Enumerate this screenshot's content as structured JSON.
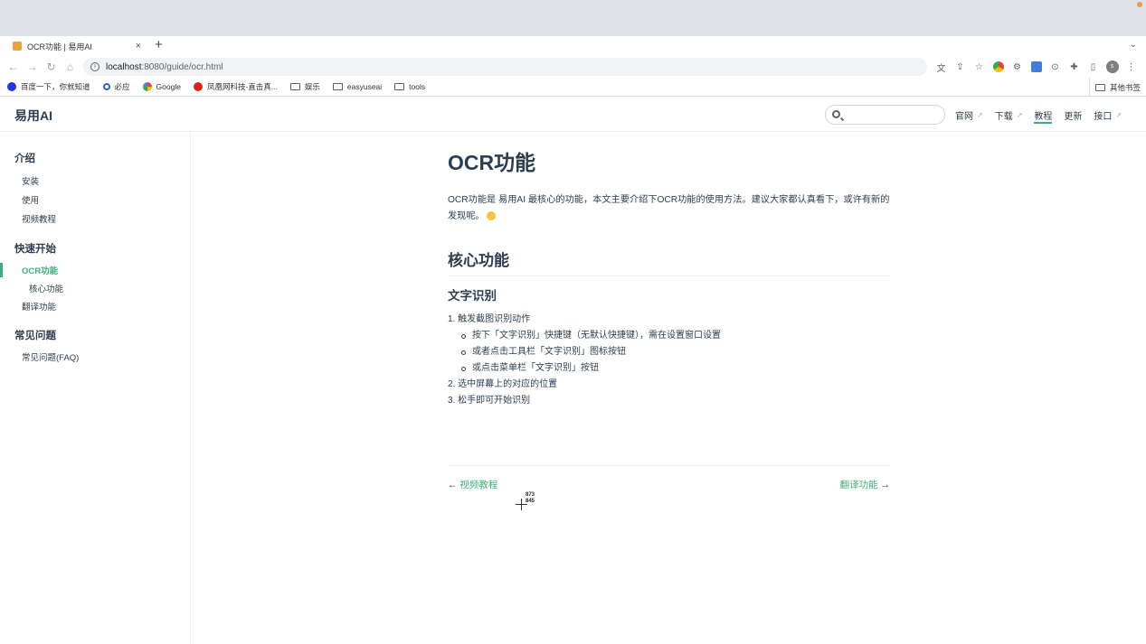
{
  "browser": {
    "tab_title": "OCR功能 | 易用AI",
    "tab_close": "×",
    "new_tab": "+",
    "url_host": "localhost",
    "url_path": ":8080/guide/ocr.html",
    "avatar_letter": "s",
    "bookmarks": [
      {
        "label": "百度一下，你就知道",
        "icon": "paw-icon"
      },
      {
        "label": "必应",
        "icon": "search-icon"
      },
      {
        "label": "Google",
        "icon": "google-icon"
      },
      {
        "label": "凤凰网科技-直击真...",
        "icon": "phoenix-icon"
      },
      {
        "label": "娱乐",
        "icon": "folder-icon"
      },
      {
        "label": "easyuseai",
        "icon": "folder-icon"
      },
      {
        "label": "tools",
        "icon": "folder-icon"
      }
    ],
    "other_bookmarks": "其他书签"
  },
  "site": {
    "title": "易用AI",
    "search_placeholder": "",
    "nav": [
      {
        "label": "官网",
        "external": true
      },
      {
        "label": "下载",
        "external": true
      },
      {
        "label": "教程",
        "active": true
      },
      {
        "label": "更新"
      },
      {
        "label": "接口",
        "external": true
      }
    ]
  },
  "sidebar": {
    "groups": [
      {
        "title": "介绍",
        "items": [
          "安装",
          "使用",
          "视频教程"
        ]
      },
      {
        "title": "快速开始",
        "items": [
          "OCR功能",
          "核心功能",
          "翻译功能"
        ]
      },
      {
        "title": "常见问题",
        "items": [
          "常见问题(FAQ)"
        ]
      }
    ]
  },
  "content": {
    "h1": "OCR功能",
    "intro": "OCR功能是 易用AI 最核心的功能，本文主要介绍下OCR功能的使用方法。建议大家都认真看下，或许有新的发现呢。",
    "h2": "核心功能",
    "h3": "文字识别",
    "steps": [
      "1. 触发截图识别动作",
      "2. 选中屏幕上的对应的位置",
      "3. 松手即可开始识别"
    ],
    "sub_steps": [
      "按下「文字识别」快捷键（无默认快捷键），需在设置窗口设置",
      "或者点击工具栏「文字识别」图标按钮",
      "或点击菜单栏「文字识别」按钮"
    ],
    "prev_label": "视频教程",
    "next_label": "翻译功能"
  },
  "cursor": {
    "x_readout": "873",
    "y_readout": "845"
  }
}
